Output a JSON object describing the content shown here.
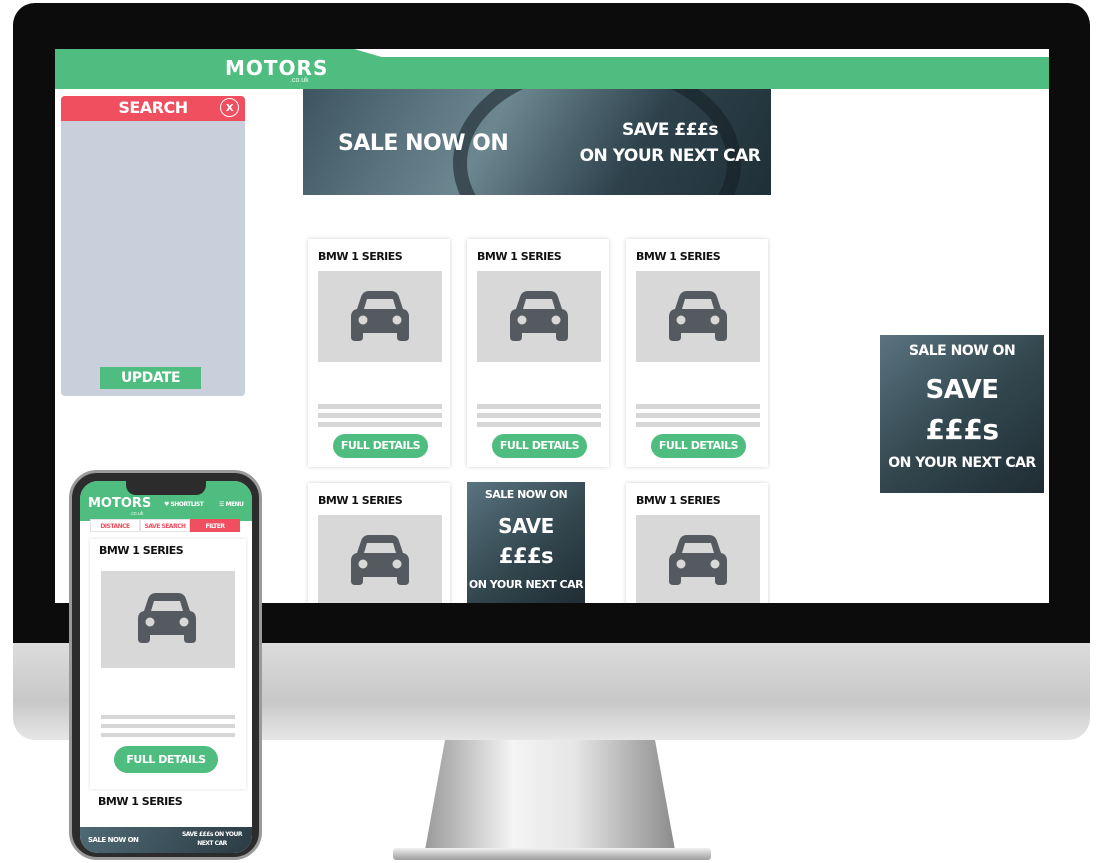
{
  "desktop": {
    "logo": "MOTORS",
    "logo_sub": ".co.uk",
    "search_panel": {
      "title": "SEARCH",
      "close_label": "X",
      "update_label": "UPDATE"
    },
    "top_banner": {
      "left_text": "SALE NOW ON",
      "right_line1": "SAVE £££s",
      "right_line2": "ON YOUR NEXT CAR"
    },
    "side_banner": {
      "line1": "SALE NOW ON",
      "line2": "SAVE",
      "line3": "£££s",
      "line4": "ON YOUR NEXT CAR"
    },
    "cards": [
      {
        "title": "BMW 1 SERIES",
        "button": "FULL DETAILS"
      },
      {
        "title": "BMW 1 SERIES",
        "button": "FULL DETAILS"
      },
      {
        "title": "BMW 1 SERIES",
        "button": "FULL DETAILS"
      },
      {
        "title": "BMW 1 SERIES"
      },
      {
        "title": "BMW 1 SERIES"
      }
    ],
    "card_ad": {
      "line1": "SALE NOW ON",
      "line2": "SAVE",
      "line3": "£££s",
      "line4": "ON YOUR NEXT CAR"
    }
  },
  "mobile": {
    "logo": "MOTORS",
    "logo_sub": ".co.uk",
    "shortlist": "♥ SHORTLIST",
    "menu": "☰ MENU",
    "tabs": [
      "DISTANCE",
      "SAVE SEARCH",
      "FILTER"
    ],
    "card_title": "BMW 1 SERIES",
    "card_button": "FULL DETAILS",
    "card2_title": "BMW 1 SERIES",
    "banner_left": "SALE NOW ON",
    "banner_right": "SAVE £££s ON YOUR NEXT CAR"
  },
  "colors": {
    "brand_green": "#4fbd7f",
    "search_red": "#ef4f5f",
    "panel_bg": "#cacfdc",
    "placeholder_gray": "#d8d8d8",
    "car_icon": "#555a60"
  },
  "icons": [
    "car-icon",
    "close-icon",
    "heart-icon",
    "menu-icon"
  ]
}
